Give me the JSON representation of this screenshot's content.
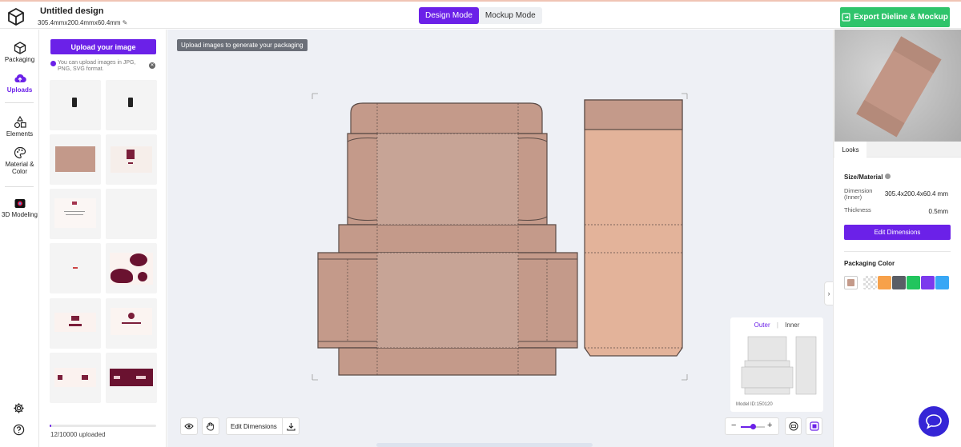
{
  "header": {
    "title": "Untitled design",
    "dimensions": "305.4mmx200.4mmx60.4mm",
    "modes": [
      "Design Mode",
      "Mockup Mode"
    ],
    "active_mode": "Design Mode",
    "export_label": "Export Dieline & Mockup"
  },
  "leftnav": {
    "items": [
      {
        "label": "Packaging",
        "icon": "cube-icon"
      },
      {
        "label": "Uploads",
        "icon": "upload-icon",
        "active": true
      },
      {
        "label": "Elements",
        "icon": "shapes-icon"
      },
      {
        "label": "Material & Color",
        "icon": "palette-icon"
      },
      {
        "label": "3D Modeling",
        "icon": "camera-icon"
      }
    ],
    "bottom_icons": [
      "settings-icon",
      "help-icon"
    ]
  },
  "uploads": {
    "button_label": "Upload your image",
    "hint": "You can upload images in JPG, PNG, SVG format.",
    "count_text": "12/10000 uploaded",
    "progress_fraction": 0.0012
  },
  "canvas": {
    "tooltip": "Upload images to generate your packaging",
    "tabs": [
      "Outer",
      "Inner"
    ],
    "active_tab": "Outer",
    "model_id": "Model ID:150120",
    "toolbar": {
      "edit_dimensions": "Edit Dimensions"
    },
    "zoom_fraction": 0.5
  },
  "right_panel": {
    "tab": "Looks",
    "size_material_label": "Size/Material",
    "dimension_label": "Dimension (Inner)",
    "dimension_value": "305.4x200.4x60.4 mm",
    "thickness_label": "Thickness",
    "thickness_value": "0.5mm",
    "edit_button": "Edit Dimensions",
    "packaging_color_label": "Packaging Color",
    "colors": [
      "#c49a8a",
      "checker",
      "#f7a14a",
      "#5a5e66",
      "#22c55e",
      "#7c3aed",
      "#38a7f5"
    ]
  },
  "colors": {
    "accent": "#6b21e8",
    "export_green": "#2fc46b",
    "kraft": "#c49a8a",
    "kraft_light": "#e3b39a"
  }
}
